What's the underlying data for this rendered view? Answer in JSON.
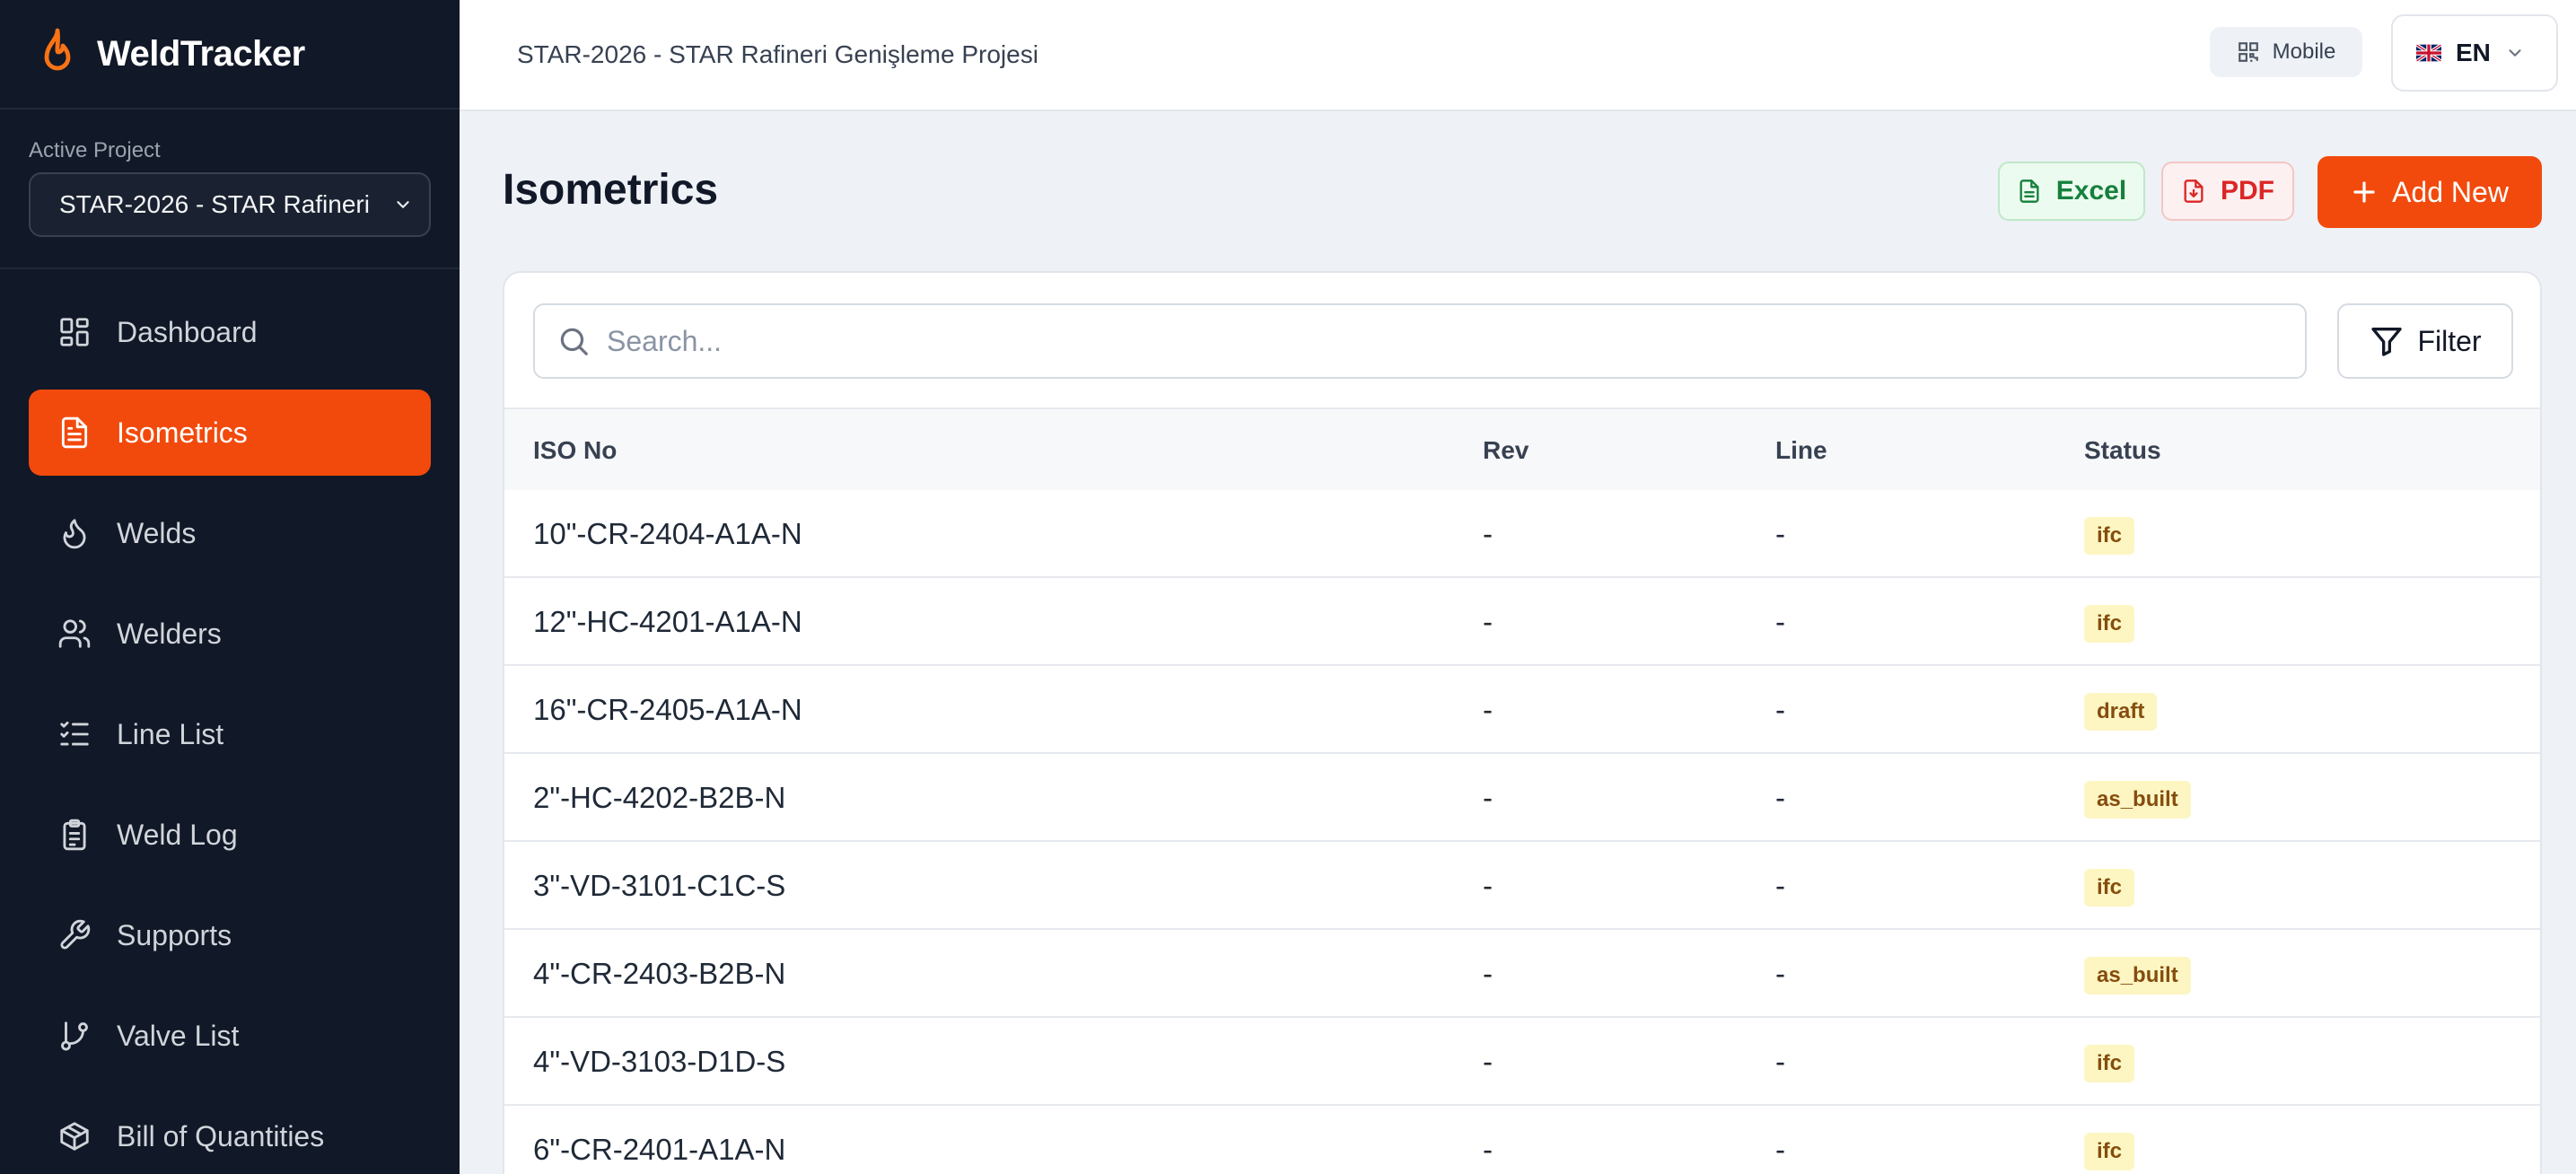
{
  "app": {
    "name": "WeldTracker"
  },
  "sidebar": {
    "project_label": "Active Project",
    "project_value": "STAR-2026 - STAR Rafineri",
    "items": [
      {
        "label": "Dashboard",
        "icon": "dashboard-icon",
        "active": false
      },
      {
        "label": "Isometrics",
        "icon": "document-icon",
        "active": true
      },
      {
        "label": "Welds",
        "icon": "flame-icon",
        "active": false
      },
      {
        "label": "Welders",
        "icon": "users-icon",
        "active": false
      },
      {
        "label": "Line List",
        "icon": "checklist-icon",
        "active": false
      },
      {
        "label": "Weld Log",
        "icon": "clipboard-icon",
        "active": false
      },
      {
        "label": "Supports",
        "icon": "wrench-icon",
        "active": false
      },
      {
        "label": "Valve List",
        "icon": "branch-icon",
        "active": false
      },
      {
        "label": "Bill of Quantities",
        "icon": "box-icon",
        "active": false
      }
    ]
  },
  "header": {
    "project_title": "STAR-2026 - STAR Rafineri Genişleme Projesi",
    "mobile_label": "Mobile",
    "language": "EN"
  },
  "page": {
    "title": "Isometrics",
    "excel_label": "Excel",
    "pdf_label": "PDF",
    "add_label": "Add New"
  },
  "search": {
    "placeholder": "Search..."
  },
  "filter_label": "Filter",
  "table": {
    "columns": [
      "ISO No",
      "Rev",
      "Line",
      "Status"
    ],
    "rows": [
      {
        "iso": "10\"-CR-2404-A1A-N",
        "rev": "-",
        "line": "-",
        "status": "ifc"
      },
      {
        "iso": "12\"-HC-4201-A1A-N",
        "rev": "-",
        "line": "-",
        "status": "ifc"
      },
      {
        "iso": "16\"-CR-2405-A1A-N",
        "rev": "-",
        "line": "-",
        "status": "draft"
      },
      {
        "iso": "2\"-HC-4202-B2B-N",
        "rev": "-",
        "line": "-",
        "status": "as_built"
      },
      {
        "iso": "3\"-VD-3101-C1C-S",
        "rev": "-",
        "line": "-",
        "status": "ifc"
      },
      {
        "iso": "4\"-CR-2403-B2B-N",
        "rev": "-",
        "line": "-",
        "status": "as_built"
      },
      {
        "iso": "4\"-VD-3103-D1D-S",
        "rev": "-",
        "line": "-",
        "status": "ifc"
      },
      {
        "iso": "6\"-CR-2401-A1A-N",
        "rev": "-",
        "line": "-",
        "status": "ifc"
      }
    ]
  },
  "colors": {
    "accent": "#f24a0c",
    "sidebar_bg": "#111827",
    "badge_bg": "#fdf6c3"
  }
}
